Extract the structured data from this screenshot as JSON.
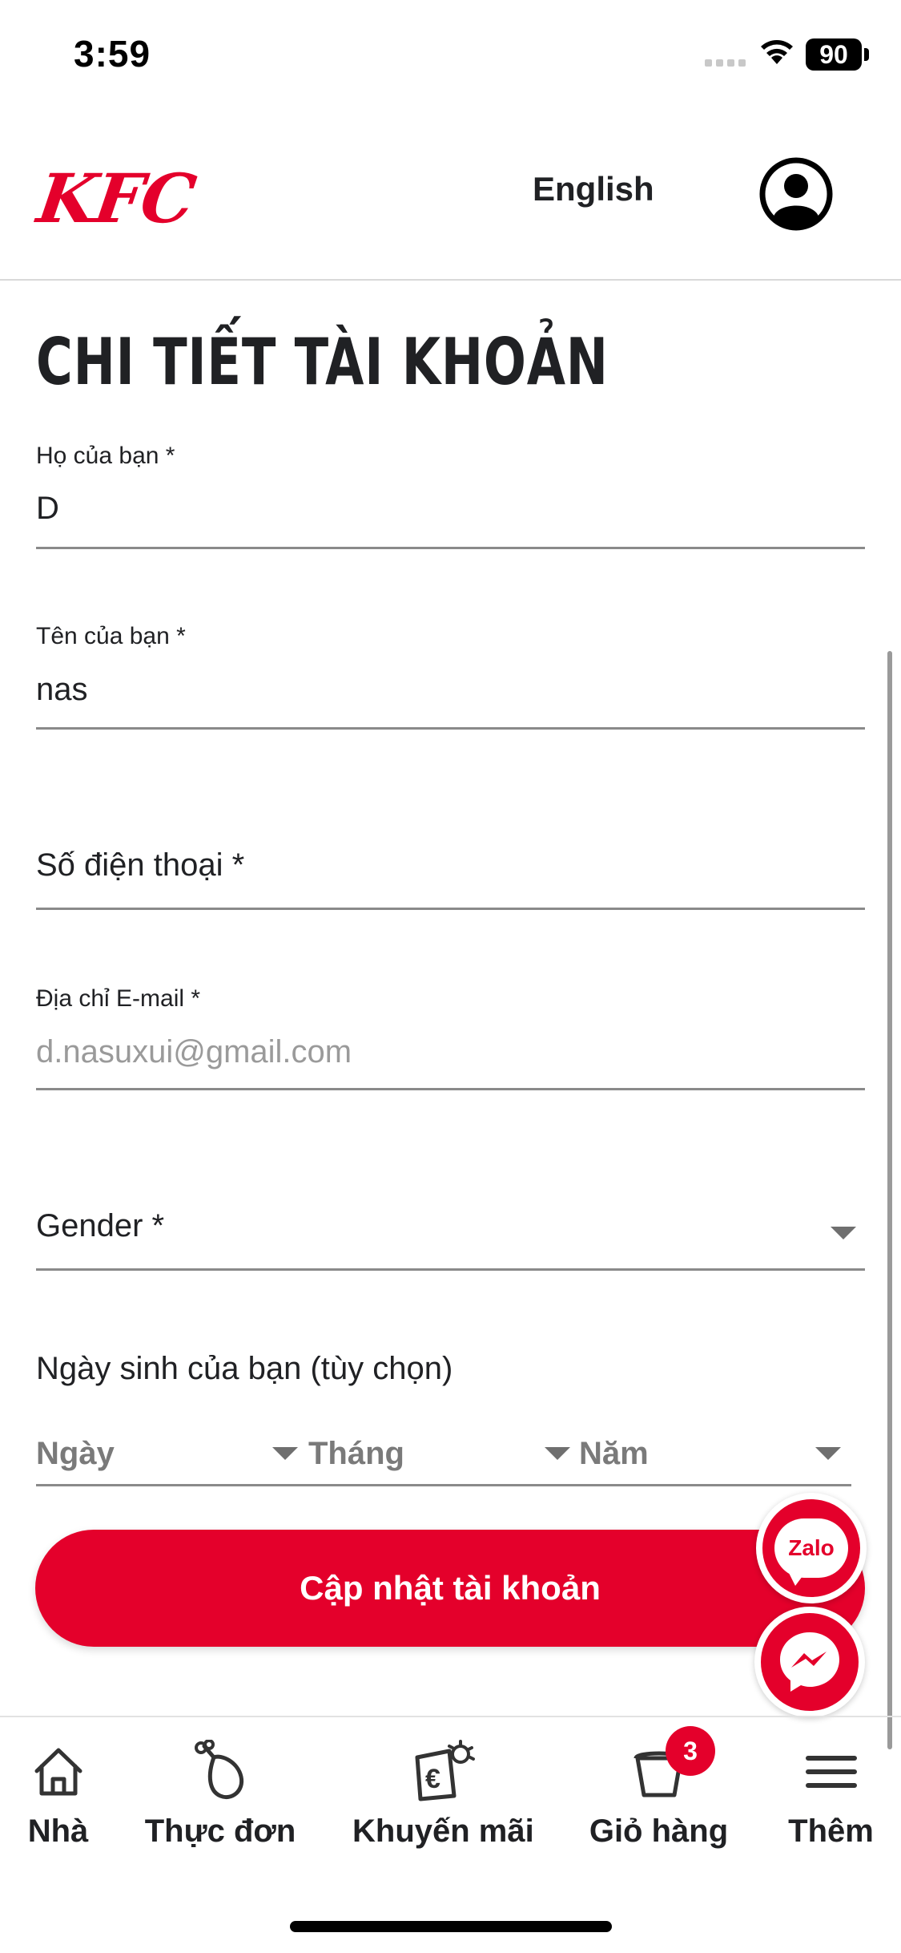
{
  "status_bar": {
    "time": "3:59",
    "battery": "90"
  },
  "header": {
    "logo_text": "KFC",
    "language_label": "English",
    "profile_icon": "user-circle-icon"
  },
  "page": {
    "title": "CHI TIẾT TÀI KHOẢN"
  },
  "form": {
    "last_name": {
      "label": "Họ của bạn *",
      "value": "D"
    },
    "first_name": {
      "label": "Tên của bạn *",
      "value": "nas"
    },
    "phone": {
      "placeholder": "Số điện thoại *"
    },
    "email": {
      "label": "Địa chỉ E-mail *",
      "value": "d.nasuxui@gmail.com"
    },
    "gender": {
      "placeholder": "Gender *"
    },
    "dob": {
      "label": "Ngày sinh của bạn (tùy chọn)",
      "day": "Ngày",
      "month": "Tháng",
      "year": "Năm"
    },
    "submit_label": "Cập nhật tài khoản"
  },
  "floating": {
    "zalo_label": "Zalo",
    "messenger_icon": "messenger-icon"
  },
  "bottom_nav": {
    "items": [
      {
        "label": "Nhà",
        "icon": "home-icon"
      },
      {
        "label": "Thực đơn",
        "icon": "drumstick-icon"
      },
      {
        "label": "Khuyến mãi",
        "icon": "promo-tag-icon"
      },
      {
        "label": "Giỏ hàng",
        "icon": "bucket-icon",
        "badge": "3"
      },
      {
        "label": "Thêm",
        "icon": "hamburger-menu-icon"
      }
    ]
  },
  "colors": {
    "brand": "#e4002b",
    "text": "#202124",
    "muted": "#9a9a9a"
  }
}
